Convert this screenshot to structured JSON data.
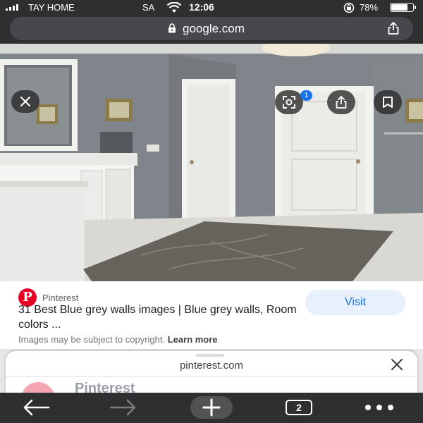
{
  "status_bar": {
    "carrier": "TAY HOME",
    "network": "SA",
    "time": "12:06",
    "battery": "78%",
    "battery_level": 0.78
  },
  "address_bar": {
    "url": "google.com",
    "icons": [
      "lock-icon",
      "share-icon"
    ]
  },
  "image_viewer": {
    "lens_badge": "1",
    "buttons": [
      "close-icon",
      "lens-icon",
      "share-icon",
      "bookmark-icon"
    ]
  },
  "result": {
    "source": "Pinterest",
    "source_logo": "P",
    "title": "31 Best Blue grey walls images | Blue grey walls, Room colors ...",
    "visit_label": "Visit",
    "copyright_text": "Images may be subject to copyright.",
    "learn_more": "Learn more"
  },
  "bottom_sheet": {
    "host": "pinterest.com",
    "peek_title": "Pinterest"
  },
  "toolbar": {
    "tab_count": "2",
    "icons": [
      "back-arrow-icon",
      "forward-arrow-icon",
      "new-tab-plus-icon",
      "tabs-icon",
      "more-menu-icon"
    ]
  },
  "colors": {
    "chrome_dark": "#2d2f31",
    "accent_blue": "#1a73e8",
    "pinterest_red": "#e60023",
    "wall_grey": "#7f858a"
  }
}
